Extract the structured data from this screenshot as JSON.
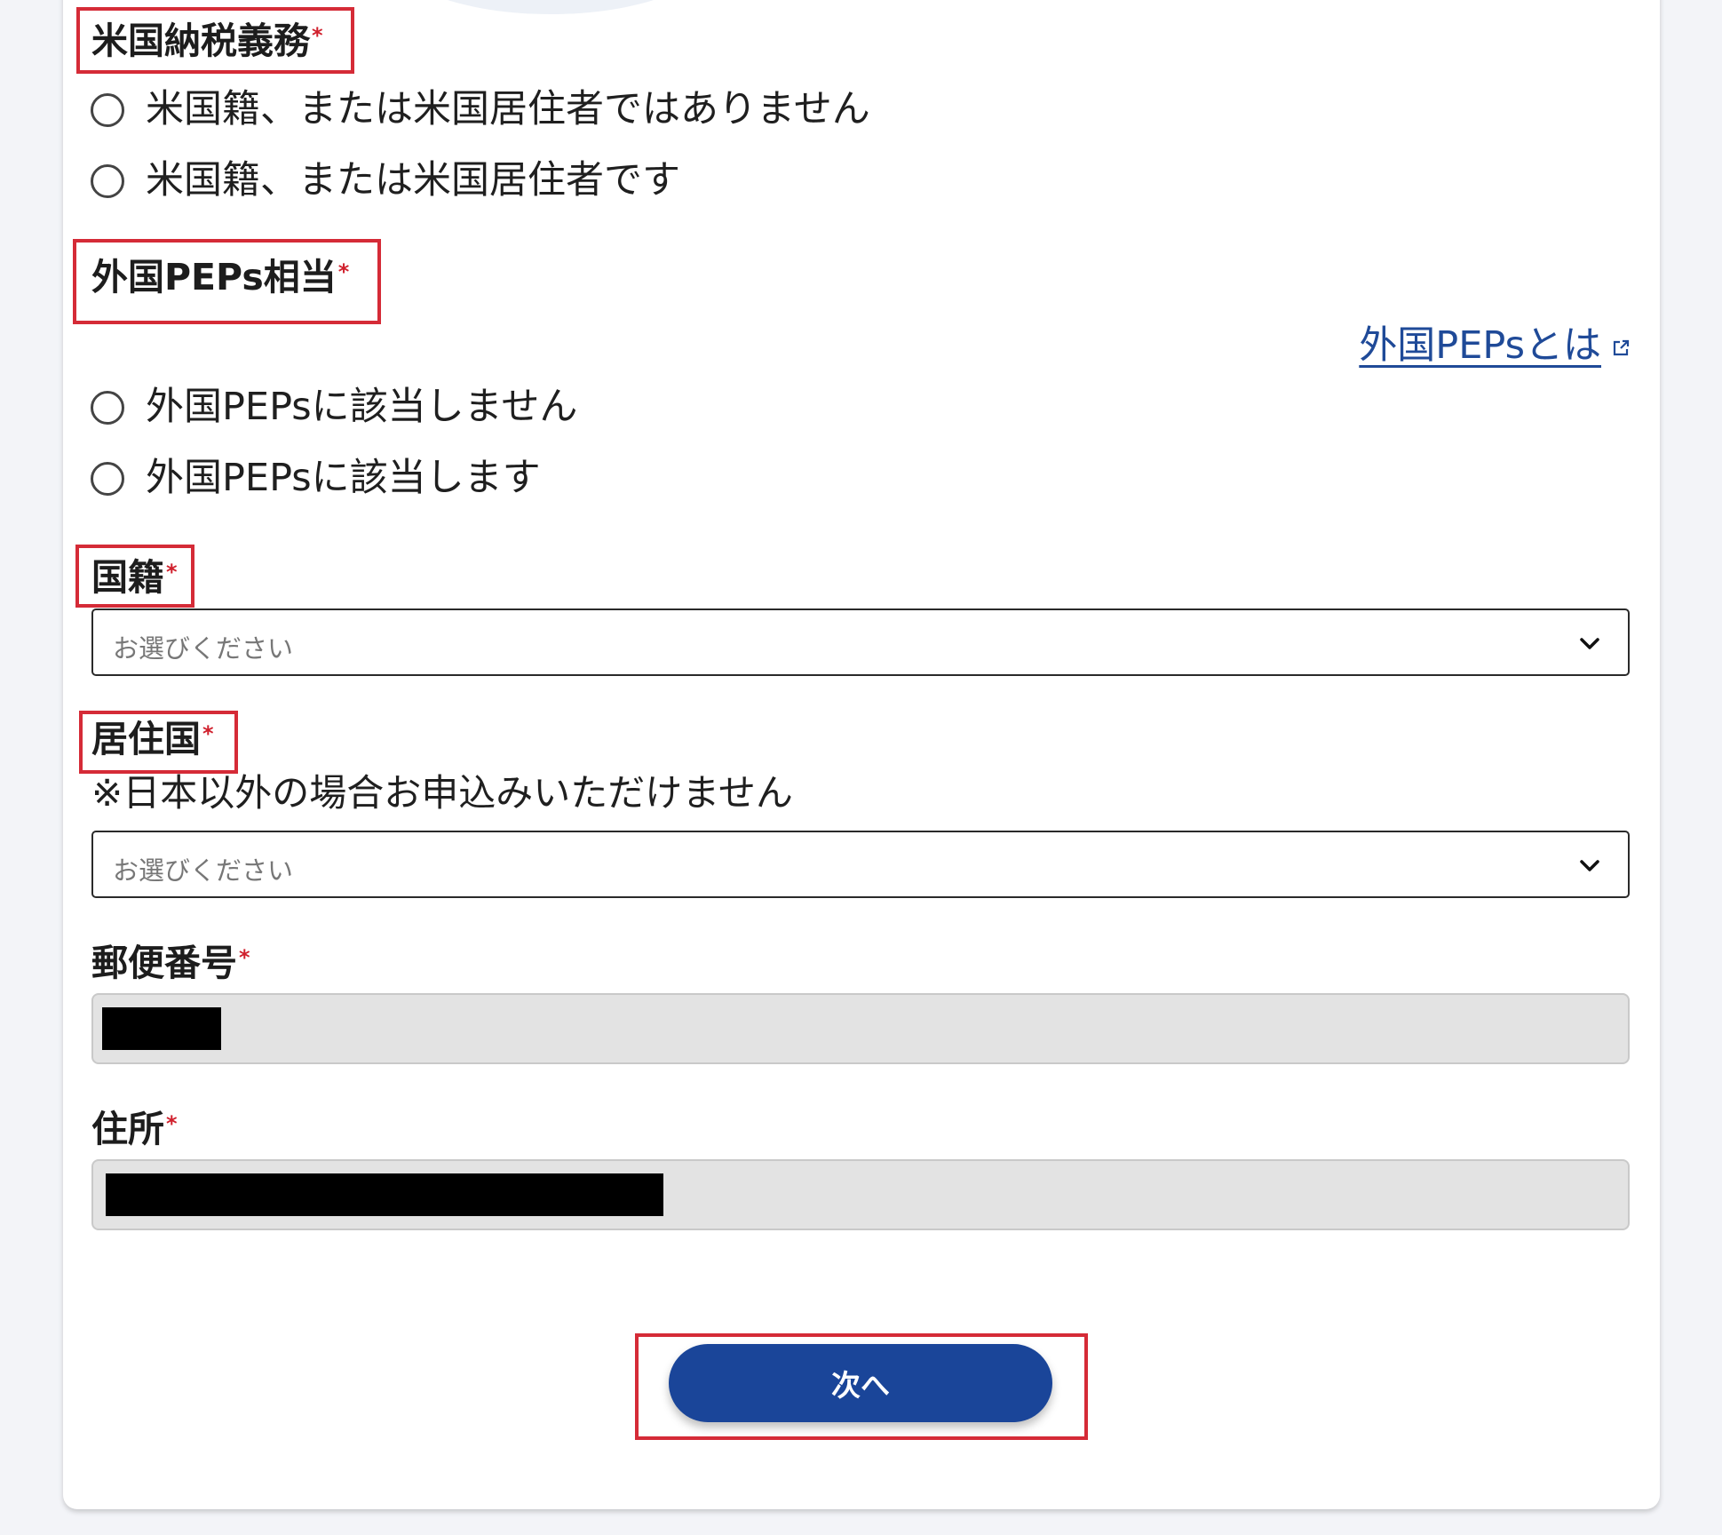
{
  "form": {
    "us_tax": {
      "label": "米国納税義務",
      "required_mark": "*",
      "options": [
        "米国籍、または米国居住者ではありません",
        "米国籍、または米国居住者です"
      ]
    },
    "foreign_peps": {
      "label": "外国PEPs相当",
      "required_mark": "*",
      "link_text": "外国PEPsとは",
      "link_icon": "external-link-icon",
      "options": [
        "外国PEPsに該当しません",
        "外国PEPsに該当します"
      ]
    },
    "nationality": {
      "label": "国籍",
      "required_mark": "*",
      "placeholder": "お選びください"
    },
    "residence_country": {
      "label": "居住国",
      "required_mark": "*",
      "note": "※日本以外の場合お申込みいただけません",
      "placeholder": "お選びください"
    },
    "postal_code": {
      "label": "郵便番号",
      "required_mark": "*"
    },
    "address": {
      "label": "住所",
      "required_mark": "*"
    },
    "next_button": "次へ"
  },
  "colors": {
    "highlight_border": "#d52b37",
    "required_mark": "#d0202d",
    "link": "#1f4a98",
    "primary_button": "#1a4599",
    "disabled_field": "#e3e3e3"
  }
}
